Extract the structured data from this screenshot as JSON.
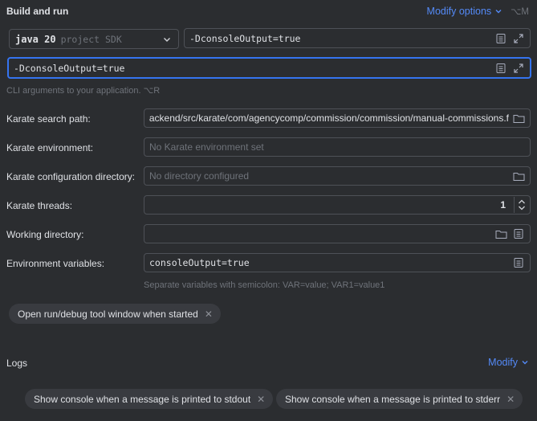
{
  "build_run": {
    "title": "Build and run",
    "modify_options_label": "Modify options",
    "modify_shortcut": "⌥M"
  },
  "sdk": {
    "version": "java 20",
    "suffix": "project SDK"
  },
  "vm_options": {
    "value": "-DconsoleOutput=true"
  },
  "cli_args": {
    "value": "-DconsoleOutput=true",
    "hint": "CLI arguments to your application. ⌥R"
  },
  "karate": {
    "search_path_label": "Karate search path:",
    "search_path_value": "backend/src/karate/com/agencycomp/commission/commission/manual-commissions.f",
    "environment_label": "Karate environment:",
    "environment_placeholder": "No Karate environment set",
    "config_dir_label": "Karate configuration directory:",
    "config_dir_placeholder": "No directory configured",
    "threads_label": "Karate threads:",
    "threads_value": "1"
  },
  "working_dir": {
    "label": "Working directory:",
    "value": ""
  },
  "env_vars": {
    "label": "Environment variables:",
    "value": "consoleOutput=true",
    "hint": "Separate variables with semicolon: VAR=value; VAR1=value1"
  },
  "chips": {
    "tool_window": "Open run/debug tool window when started"
  },
  "logs": {
    "title": "Logs",
    "modify_label": "Modify",
    "chip_stdout": "Show console when a message is printed to stdout",
    "chip_stderr": "Show console when a message is printed to stderr"
  },
  "icons": {
    "dropdown": "chevron-down-icon",
    "expand": "expand-icon",
    "macro": "list-icon",
    "folder": "folder-icon",
    "close": "close-icon"
  },
  "colors": {
    "background": "#2b2d30",
    "accent": "#548af7",
    "focus_border": "#3574f0",
    "chip_bg": "#393b40"
  }
}
